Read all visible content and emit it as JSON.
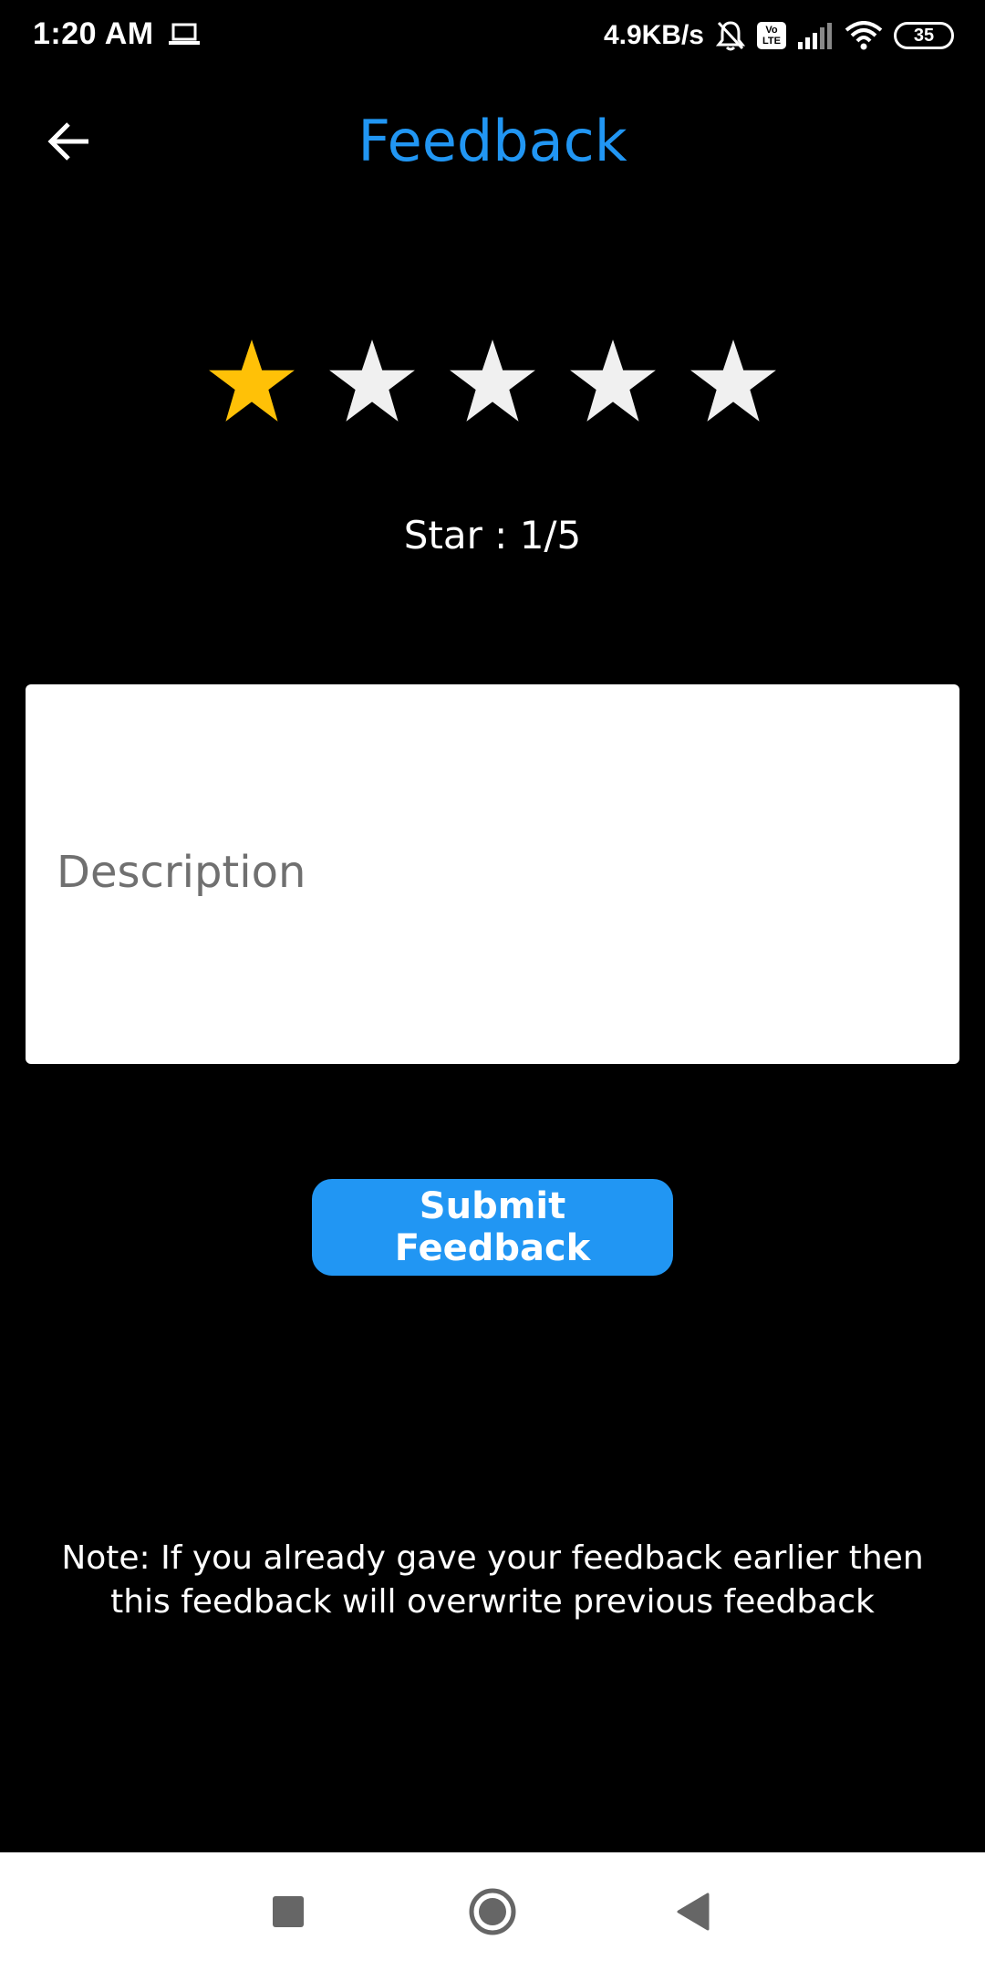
{
  "status_bar": {
    "time": "1:20 AM",
    "net_speed": "4.9KB/s",
    "battery": "35",
    "volte_top": "Vo",
    "volte_bottom": "LTE",
    "icons": [
      "laptop-icon",
      "bell-off-icon",
      "volte-icon",
      "signal-icon",
      "wifi-icon",
      "battery-icon"
    ]
  },
  "toolbar": {
    "title": "Feedback",
    "back_icon": "arrow-left-icon"
  },
  "rating": {
    "selected": 1,
    "max": 5,
    "label": "Star : 1/5",
    "active_color": "#FFC107",
    "inactive_color": "#F0F0F0"
  },
  "form": {
    "description_placeholder": "Description",
    "description_value": "",
    "submit_label": "Submit Feedback"
  },
  "note": {
    "text": "Note: If you already gave your feedback earlier then this feedback will overwrite previous feedback"
  },
  "nav_bar": {
    "icons": [
      "recents-square-icon",
      "home-circle-icon",
      "back-triangle-icon"
    ]
  },
  "colors": {
    "accent": "#2196F3",
    "background": "#000000"
  }
}
